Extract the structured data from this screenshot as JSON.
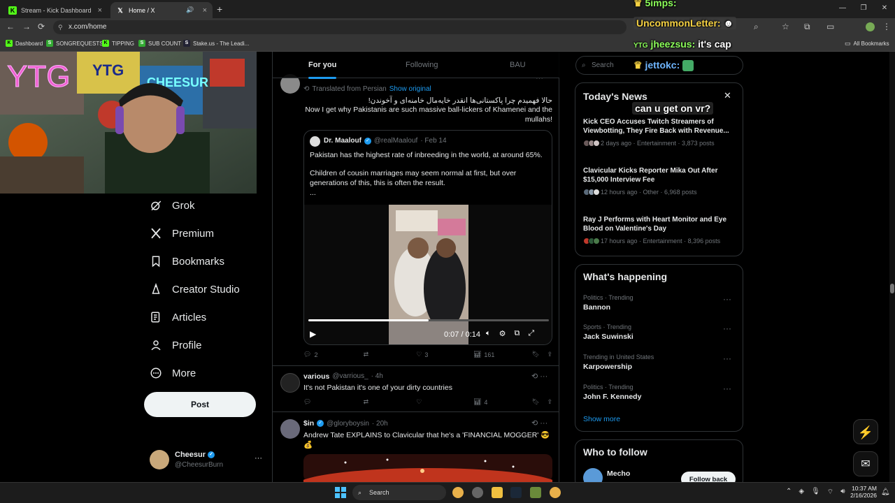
{
  "browser": {
    "tabs": [
      {
        "label": "Stream - Kick Dashboard",
        "close": "×"
      },
      {
        "label": "Home / X",
        "close": "×"
      }
    ],
    "new_tab": "+",
    "url": "x.com/home",
    "bookmarks": [
      "Dashboard",
      "SONGREQUESTS",
      "TIPPING",
      "SUB COUNT",
      "Stake.us - The Leadi..."
    ],
    "all_bookmarks": "All Bookmarks"
  },
  "nav": {
    "items": [
      {
        "label": "Grok"
      },
      {
        "label": "Premium"
      },
      {
        "label": "Bookmarks"
      },
      {
        "label": "Creator Studio"
      },
      {
        "label": "Articles"
      },
      {
        "label": "Profile"
      },
      {
        "label": "More"
      }
    ],
    "post_label": "Post",
    "account_name": "Cheesur",
    "account_handle": "@CheesurBurn",
    "account_more": "···"
  },
  "feed": {
    "tabs": [
      "For you",
      "Following",
      "BAU"
    ],
    "tweets": [
      {
        "translated_label": "Translated from Persian",
        "show_original": "Show original",
        "original_text": "حالا فهمیدم چرا پاکستانی‌ها انقدر خایه‌مال خامنه‌ای و آخوندن!",
        "translated_text": "Now I get why Pakistanis are such massive ball-lickers of Khamenei and the mullahs!",
        "quote": {
          "name": "Dr. Maalouf",
          "handle": "@realMaalouf",
          "date": "· Feb 14",
          "line1": "Pakistan has the highest rate of inbreeding in the world, at around 65%.",
          "line2": "Children of cousin marriages may seem normal at first, but over generations of this, this is often the result.",
          "ellipsis": "...",
          "video_time": "0:07 / 0:14"
        },
        "stats": {
          "replies": "2",
          "retweets": "",
          "likes": "3",
          "views": "161"
        }
      },
      {
        "name": "various",
        "handle": "@varrious_",
        "time": "· 4h",
        "text": "It's not Pakistan it's one of your dirty countries",
        "stats": {
          "views": "4"
        }
      },
      {
        "name": "$in",
        "handle": "@gloryboysin",
        "time": "· 20h",
        "text": "Andrew Tate EXPLAINS to Clavicular that he's a 'FINANCIAL MOGGER' 😎💰"
      }
    ]
  },
  "sidebar": {
    "search_placeholder": "Search",
    "todays_news": {
      "title": "Today's News",
      "items": [
        {
          "title": "Kick CEO Accuses Twitch Streamers of Viewbotting, They Fire Back with Revenue...",
          "meta": "2 days ago · Entertainment · 3,873 posts"
        },
        {
          "title": "Clavicular Kicks Reporter Mika Out After $15,000 Interview Fee",
          "meta": "12 hours ago · Other · 6,968 posts"
        },
        {
          "title": "Ray J Performs with Heart Monitor and Eye Blood on Valentine's Day",
          "meta": "17 hours ago · Entertainment · 8,396 posts"
        }
      ]
    },
    "whats_happening": {
      "title": "What's happening",
      "trends": [
        {
          "category": "Politics · Trending",
          "name": "Bannon"
        },
        {
          "category": "Sports · Trending",
          "name": "Jack Suwinski"
        },
        {
          "category": "Trending in United States",
          "name": "Karpowership"
        },
        {
          "category": "Politics · Trending",
          "name": "John F. Kennedy"
        }
      ],
      "show_more": "Show more"
    },
    "who_to_follow": {
      "title": "Who to follow",
      "name": "Mecho",
      "follow_label": "Follow back"
    }
  },
  "chat_overlay": [
    {
      "user": "5imps:",
      "text": ""
    },
    {
      "user": "UncommonLetter:",
      "text": ""
    },
    {
      "user": "jheezsus:",
      "text": "it's cap"
    },
    {
      "user": "jettokc:",
      "text": ""
    },
    {
      "user": "",
      "text": "can u get on vr?"
    }
  ],
  "taskbar": {
    "search": "Search",
    "time": "10:37 AM",
    "date": "2/16/2026"
  },
  "colors": {
    "accent": "#1d9bf0",
    "kick_green": "#53fc18",
    "chat_green": "#8cff5a",
    "chat_yellow": "#f5d142",
    "chat_blue": "#6fb6ff"
  }
}
